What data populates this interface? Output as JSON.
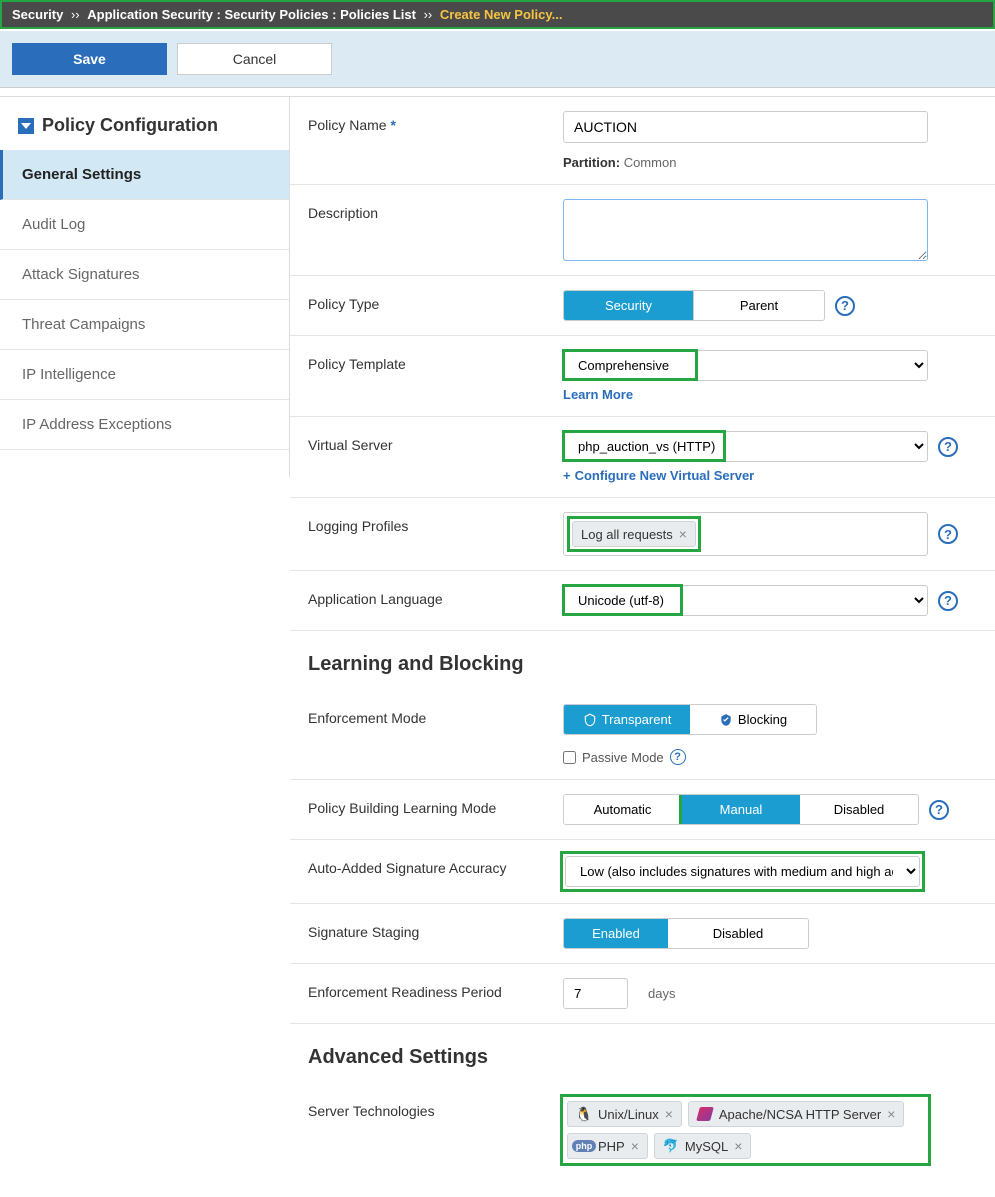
{
  "breadcrumb": {
    "root": "Security",
    "path": "Application Security : Security Policies : Policies List",
    "current": "Create New Policy..."
  },
  "actions": {
    "save": "Save",
    "cancel": "Cancel"
  },
  "sidebar": {
    "title": "Policy Configuration",
    "items": [
      {
        "label": "General Settings",
        "active": true
      },
      {
        "label": "Audit Log"
      },
      {
        "label": "Attack Signatures"
      },
      {
        "label": "Threat Campaigns"
      },
      {
        "label": "IP Intelligence"
      },
      {
        "label": "IP Address Exceptions"
      }
    ]
  },
  "general": {
    "policy_name_label": "Policy Name",
    "policy_name_value": "AUCTION",
    "partition_label": "Partition:",
    "partition_value": "Common",
    "description_label": "Description",
    "policy_type_label": "Policy Type",
    "type_security": "Security",
    "type_parent": "Parent",
    "policy_template_label": "Policy Template",
    "policy_template_value": "Comprehensive",
    "learn_more": "Learn More",
    "virtual_server_label": "Virtual Server",
    "virtual_server_value": "php_auction_vs (HTTP)",
    "configure_new_vs": "Configure New Virtual Server",
    "logging_profiles_label": "Logging Profiles",
    "logging_profile_chip": "Log all requests",
    "app_language_label": "Application Language",
    "app_language_value": "Unicode (utf-8)"
  },
  "learning": {
    "section_title": "Learning and Blocking",
    "enforcement_mode_label": "Enforcement Mode",
    "transparent": "Transparent",
    "blocking": "Blocking",
    "passive_mode": "Passive Mode",
    "learning_mode_label": "Policy Building Learning Mode",
    "automatic": "Automatic",
    "manual": "Manual",
    "disabled": "Disabled",
    "auto_sig_label": "Auto-Added Signature Accuracy",
    "auto_sig_value": "Low (also includes signatures with medium and high accuracy)",
    "sig_staging_label": "Signature Staging",
    "enabled": "Enabled",
    "readiness_label": "Enforcement Readiness Period",
    "readiness_value": "7",
    "days": "days"
  },
  "advanced": {
    "section_title": "Advanced Settings",
    "server_tech_label": "Server Technologies",
    "techs": [
      {
        "label": "Unix/Linux",
        "icon": "linux"
      },
      {
        "label": "Apache/NCSA HTTP Server",
        "icon": "apache"
      },
      {
        "label": "PHP",
        "icon": "php"
      },
      {
        "label": "MySQL",
        "icon": "mysql"
      }
    ]
  }
}
